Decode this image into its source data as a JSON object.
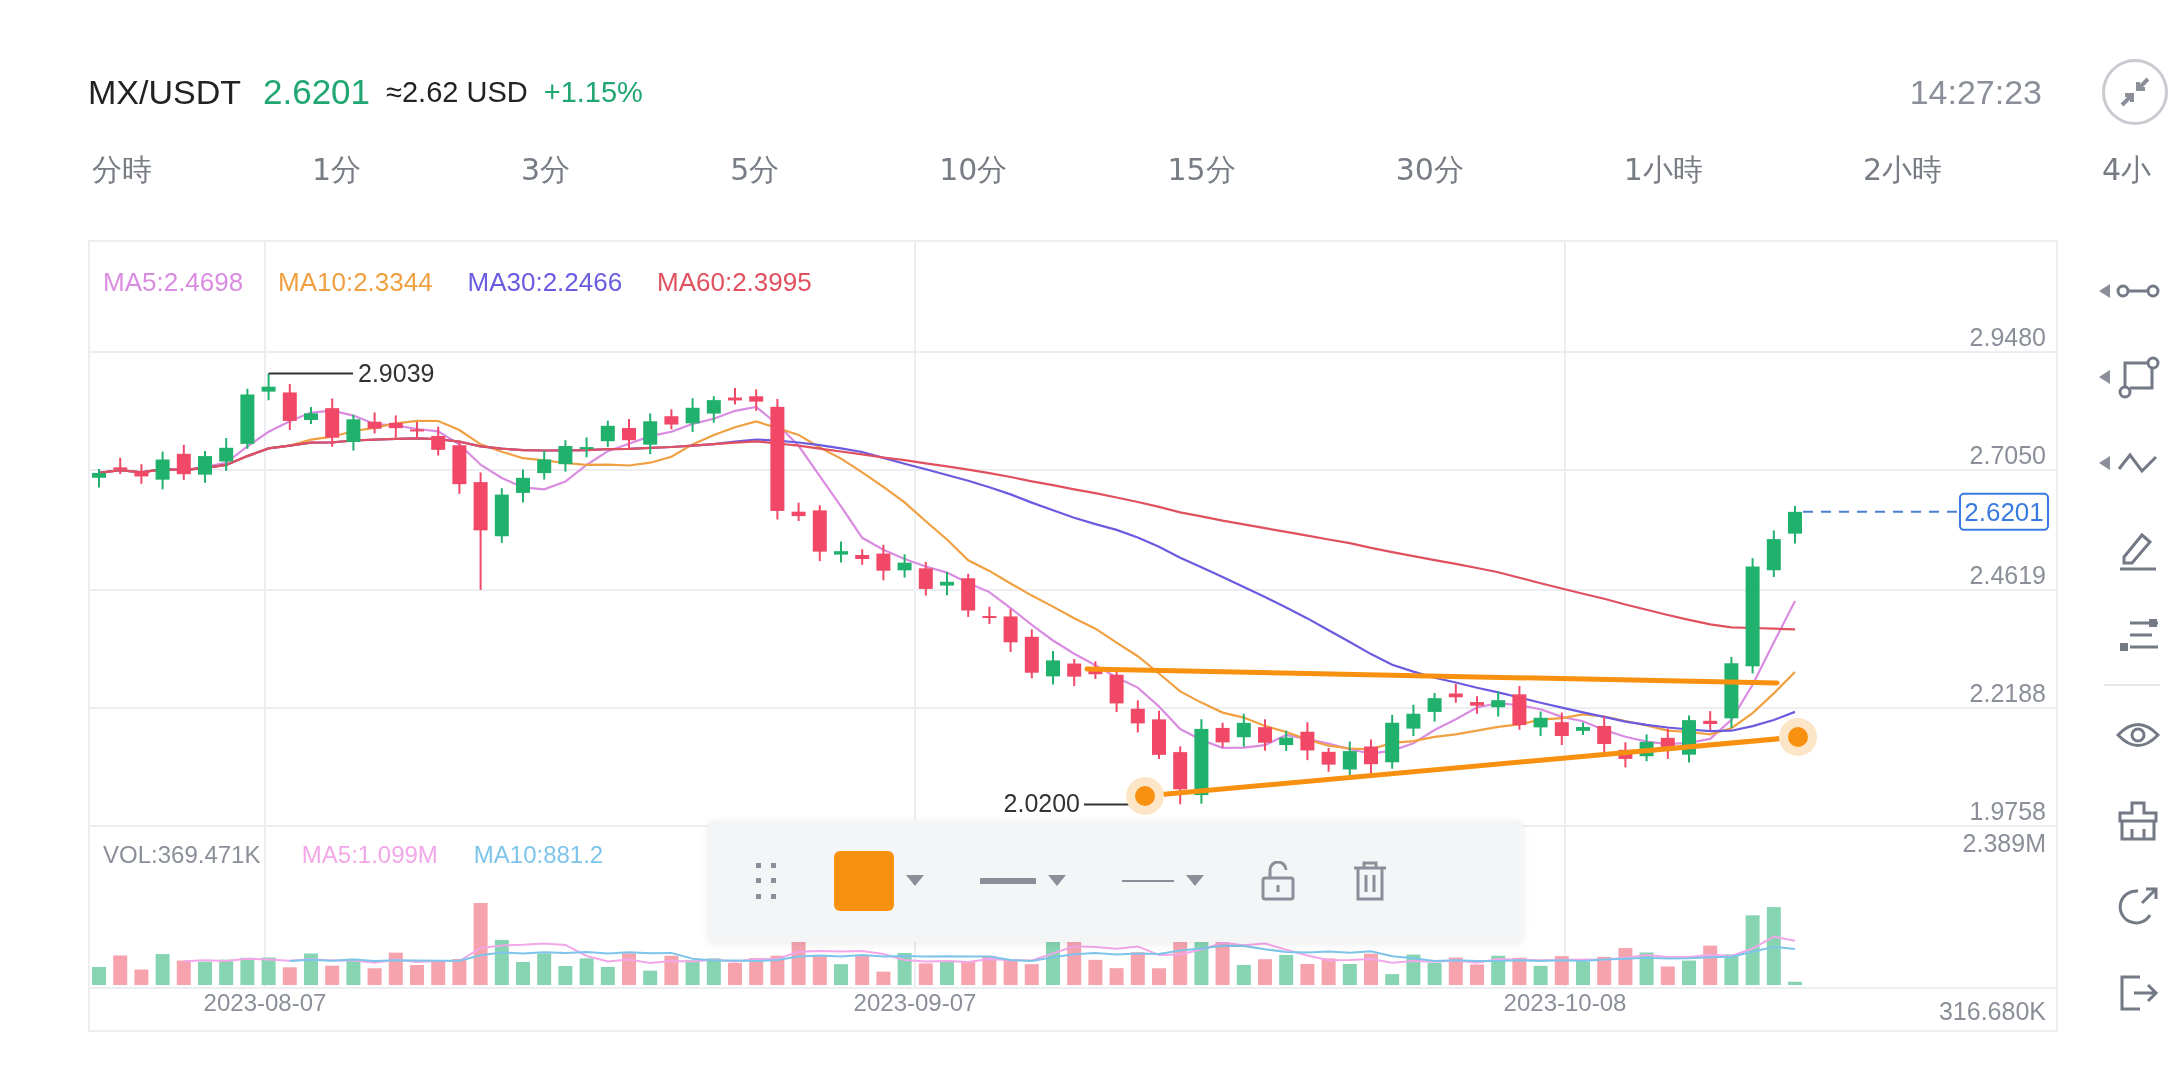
{
  "header": {
    "pair": "MX/USDT",
    "price": "2.6201",
    "usd_value": "≈2.62 USD",
    "change": "+1.15%",
    "time": "14:27:23"
  },
  "interval_tabs": [
    {
      "label": "分時",
      "selected": false
    },
    {
      "label": "1分",
      "selected": false
    },
    {
      "label": "3分",
      "selected": false
    },
    {
      "label": "5分",
      "selected": false
    },
    {
      "label": "10分",
      "selected": false
    },
    {
      "label": "15分",
      "selected": false
    },
    {
      "label": "30分",
      "selected": false
    },
    {
      "label": "1小時",
      "selected": false
    },
    {
      "label": "2小時",
      "selected": false
    },
    {
      "label": "4小",
      "selected": false
    }
  ],
  "chart": {
    "legend": [
      {
        "label": "MA5:2.4698",
        "color": "#d98ce0"
      },
      {
        "label": "MA10:2.3344",
        "color": "#f0a040"
      },
      {
        "label": "MA30:2.2466",
        "color": "#6a5be0"
      },
      {
        "label": "MA60:2.3995",
        "color": "#e0505e"
      }
    ],
    "price_axis": [
      "2.9480",
      "2.7050",
      "2.4619",
      "2.2188",
      "1.9758"
    ],
    "high_marker": "2.9039",
    "low_marker": "2.0200",
    "last_price": "2.6201",
    "volume_legend": [
      {
        "label": "VOL:369.471K",
        "color": "#8a8f99"
      },
      {
        "label": "MA5:1.099M",
        "color": "#f2a7e8"
      },
      {
        "label": "MA10:881.2",
        "color": "#7dc4ea"
      }
    ],
    "volume_axis": [
      "2.389M",
      "316.680K"
    ],
    "dates": [
      "2023-08-07",
      "2023-09-07",
      "2023-10-08"
    ]
  },
  "drawing_toolbar": {
    "color": "#f7910f"
  }
}
